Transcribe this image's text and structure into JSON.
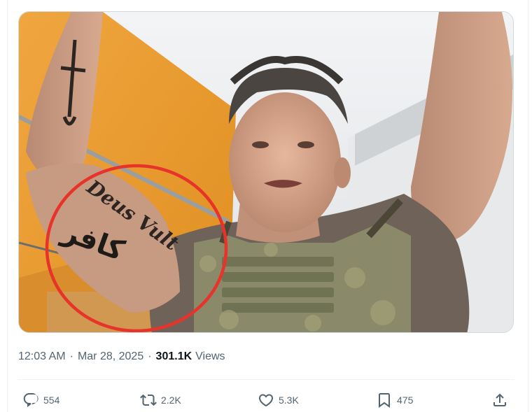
{
  "tweet": {
    "media_alt": "",
    "time": "12:03 AM",
    "separator": "·",
    "date": "Mar 28, 2025",
    "views_count": "301.1K",
    "views_label": "Views"
  },
  "actions": {
    "reply": {
      "icon": "reply-icon",
      "count": "554"
    },
    "retweet": {
      "icon": "retweet-icon",
      "count": "2.2K"
    },
    "like": {
      "icon": "heart-icon",
      "count": "5.3K"
    },
    "bookmark": {
      "icon": "bookmark-icon",
      "count": "475"
    },
    "share": {
      "icon": "share-icon"
    }
  },
  "photo": {
    "tattoo_text_line1": "Deus Vult",
    "tattoo_text_line2": "كافر",
    "annotation_color": "#e8332a"
  },
  "colors": {
    "text_secondary": "#536471",
    "text_primary": "#0f1419",
    "annotation": "#e8332a"
  }
}
